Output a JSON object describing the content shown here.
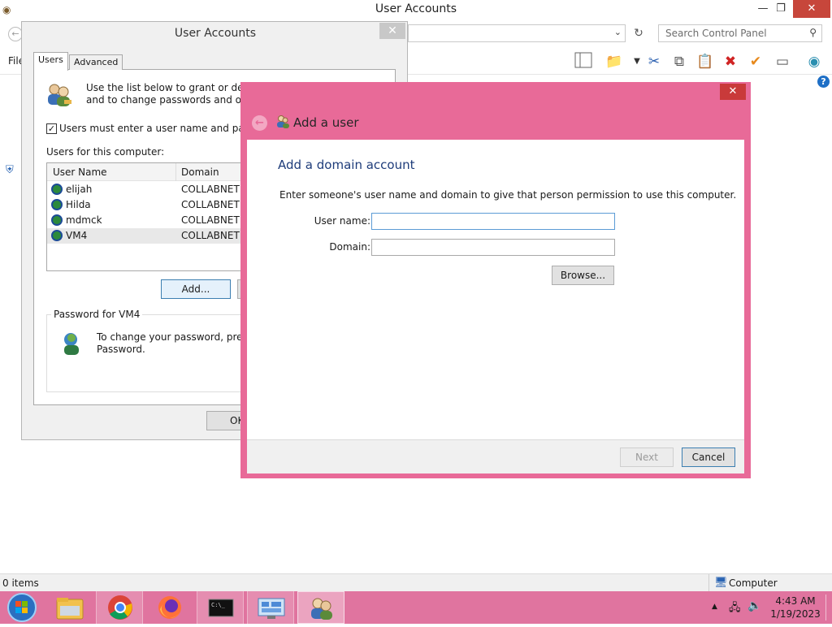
{
  "explorer": {
    "title": "User Accounts",
    "search_placeholder": "Search Control Panel",
    "menu_file": "File",
    "status_items": "0 items",
    "status_location": "Computer"
  },
  "user_accounts": {
    "title": "User Accounts",
    "tabs": [
      "Users",
      "Advanced"
    ],
    "intro_line1": "Use the list below to grant or deny u",
    "intro_line2": "and to change passwords and other",
    "checkbox_label": "Users must enter a user name and passwor",
    "checkbox_checked": true,
    "users_label": "Users for this computer:",
    "columns": [
      "User Name",
      "Domain"
    ],
    "users": [
      {
        "name": "elijah",
        "domain": "COLLABNET"
      },
      {
        "name": "Hilda",
        "domain": "COLLABNET"
      },
      {
        "name": "mdmck",
        "domain": "COLLABNET"
      },
      {
        "name": "VM4",
        "domain": "COLLABNET"
      }
    ],
    "selected_user": "VM4",
    "add_button": "Add...",
    "password_group": "Password for VM4",
    "password_line1": "To change your password, press C",
    "password_line2": "Password.",
    "ok_button": "OK"
  },
  "wizard": {
    "title": "Add a user",
    "heading": "Add a domain account",
    "description": "Enter someone's user name and domain to give that person permission to use this computer.",
    "username_label": "User name:",
    "username_value": "",
    "domain_label": "Domain:",
    "domain_value": "",
    "browse_button": "Browse...",
    "next_button": "Next",
    "cancel_button": "Cancel"
  },
  "taskbar": {
    "apps": [
      "start",
      "file-explorer",
      "chrome",
      "firefox",
      "command-prompt",
      "remote-desktop",
      "user-accounts"
    ],
    "time": "4:43 AM",
    "date": "1/19/2023"
  },
  "colors": {
    "accent": "#e86a98",
    "taskbar": "#e0749f",
    "heading": "#1e3c7a",
    "close": "#c93a3a"
  }
}
